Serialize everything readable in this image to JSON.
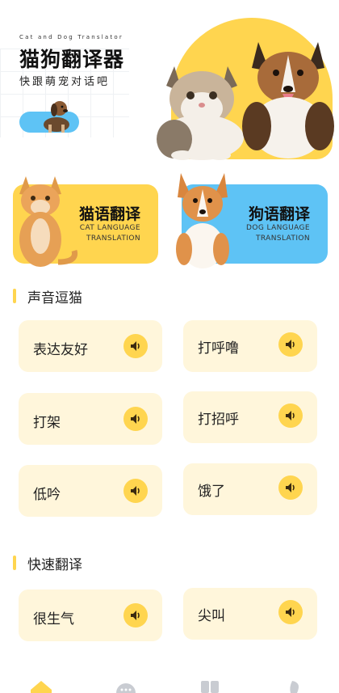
{
  "header": {
    "tagline": "Cat and Dog Translator",
    "title": "猫狗翻译器",
    "subtitle": "快跟萌宠对话吧"
  },
  "cards": {
    "cat": {
      "title": "猫语翻译",
      "en_line1": "CAT LANGUAGE",
      "en_line2": "TRANSLATION"
    },
    "dog": {
      "title": "狗语翻译",
      "en_line1": "DOG LANGUAGE",
      "en_line2": "TRANSLATION"
    }
  },
  "sections": {
    "tease_cat": "声音逗猫",
    "quick": "快速翻译"
  },
  "sounds": [
    "表达友好",
    "打呼噜",
    "打架",
    "打招呼",
    "低吟",
    "饿了"
  ],
  "quick_items": [
    "很生气",
    "尖叫"
  ],
  "colors": {
    "accent_yellow": "#ffd54f",
    "accent_blue": "#5ec3f5",
    "tile_bg": "#fff6db"
  },
  "icons": {
    "speaker": "speaker-icon",
    "tabs": [
      "home-icon",
      "chat-icon",
      "book-icon",
      "profile-icon"
    ]
  }
}
